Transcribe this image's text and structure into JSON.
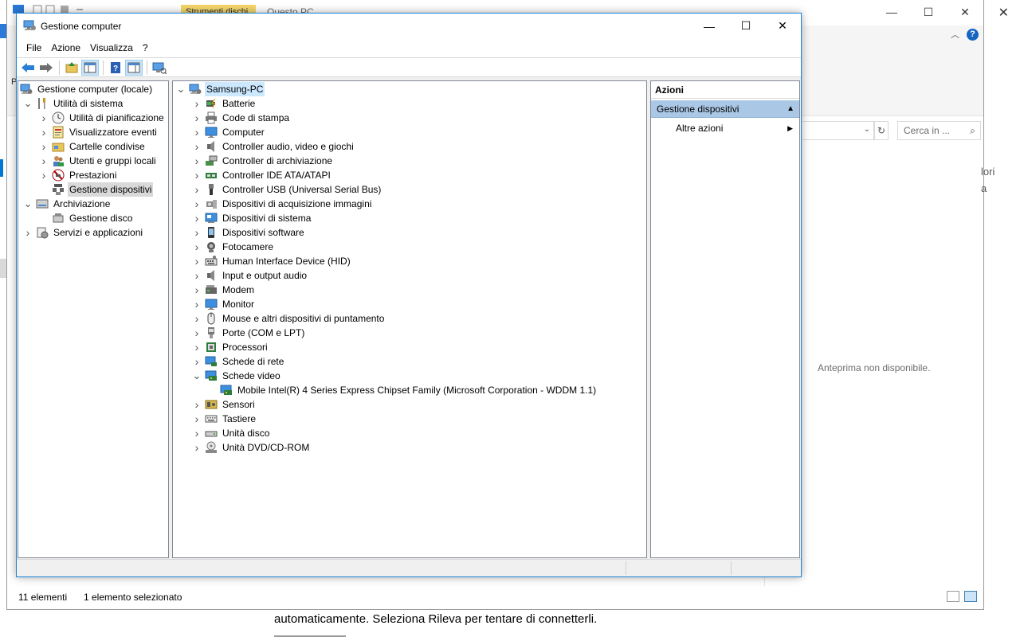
{
  "explorer": {
    "tab_tools": "Strumenti dischi",
    "tab_title": "Questo PC",
    "help": "?",
    "search_placeholder": "Cerca in ...",
    "side_text_line1": "lori",
    "side_text_line2": "a",
    "preview_text": "Anteprima non disponibile.",
    "status_count": "11 elementi",
    "status_selected": "1 elemento selezionato"
  },
  "settings_background": {
    "message": "automaticamente. Seleziona Rileva per tentare di connetterli."
  },
  "window": {
    "title": "Gestione computer",
    "menu": [
      "File",
      "Azione",
      "Visualizza",
      "?"
    ]
  },
  "tree": [
    {
      "label": "Gestione computer (locale)",
      "icon": "computer-management-icon",
      "level": 0,
      "expander": "none"
    },
    {
      "label": "Utilità di sistema",
      "icon": "tools-icon",
      "level": 1,
      "expander": "expanded"
    },
    {
      "label": "Utilità di pianificazione",
      "icon": "clock-icon",
      "level": 2,
      "expander": "collapsed"
    },
    {
      "label": "Visualizzatore eventi",
      "icon": "event-viewer-icon",
      "level": 2,
      "expander": "collapsed"
    },
    {
      "label": "Cartelle condivise",
      "icon": "shared-folder-icon",
      "level": 2,
      "expander": "collapsed"
    },
    {
      "label": "Utenti e gruppi locali",
      "icon": "users-icon",
      "level": 2,
      "expander": "collapsed"
    },
    {
      "label": "Prestazioni",
      "icon": "performance-icon",
      "level": 2,
      "expander": "collapsed"
    },
    {
      "label": "Gestione dispositivi",
      "icon": "device-manager-icon",
      "level": 2,
      "expander": "none",
      "selected": true
    },
    {
      "label": "Archiviazione",
      "icon": "storage-icon",
      "level": 1,
      "expander": "expanded"
    },
    {
      "label": "Gestione disco",
      "icon": "disk-management-icon",
      "level": 2,
      "expander": "none"
    },
    {
      "label": "Servizi e applicazioni",
      "icon": "services-icon",
      "level": 1,
      "expander": "collapsed"
    }
  ],
  "devices": {
    "root": "Samsung-PC",
    "items": [
      {
        "label": "Batterie",
        "icon": "battery-icon",
        "expander": "collapsed"
      },
      {
        "label": "Code di stampa",
        "icon": "printer-icon",
        "expander": "collapsed"
      },
      {
        "label": "Computer",
        "icon": "monitor-icon",
        "expander": "collapsed"
      },
      {
        "label": "Controller audio, video e giochi",
        "icon": "speaker-icon",
        "expander": "collapsed"
      },
      {
        "label": "Controller di archiviazione",
        "icon": "storage-controller-icon",
        "expander": "collapsed"
      },
      {
        "label": "Controller IDE ATA/ATAPI",
        "icon": "ide-controller-icon",
        "expander": "collapsed"
      },
      {
        "label": "Controller USB (Universal Serial Bus)",
        "icon": "usb-icon",
        "expander": "collapsed"
      },
      {
        "label": "Dispositivi di acquisizione immagini",
        "icon": "camera-device-icon",
        "expander": "collapsed"
      },
      {
        "label": "Dispositivi di sistema",
        "icon": "system-device-icon",
        "expander": "collapsed"
      },
      {
        "label": "Dispositivi software",
        "icon": "software-device-icon",
        "expander": "collapsed"
      },
      {
        "label": "Fotocamere",
        "icon": "webcam-icon",
        "expander": "collapsed"
      },
      {
        "label": "Human Interface Device (HID)",
        "icon": "hid-icon",
        "expander": "collapsed"
      },
      {
        "label": "Input e output audio",
        "icon": "speaker-icon",
        "expander": "collapsed"
      },
      {
        "label": "Modem",
        "icon": "modem-icon",
        "expander": "collapsed"
      },
      {
        "label": "Monitor",
        "icon": "monitor-icon",
        "expander": "collapsed"
      },
      {
        "label": "Mouse e altri dispositivi di puntamento",
        "icon": "mouse-icon",
        "expander": "collapsed"
      },
      {
        "label": "Porte (COM e LPT)",
        "icon": "port-icon",
        "expander": "collapsed"
      },
      {
        "label": "Processori",
        "icon": "processor-icon",
        "expander": "collapsed"
      },
      {
        "label": "Schede di rete",
        "icon": "network-adapter-icon",
        "expander": "collapsed"
      },
      {
        "label": "Schede video",
        "icon": "display-adapter-icon",
        "expander": "expanded"
      },
      {
        "label": "Mobile Intel(R) 4 Series Express Chipset Family (Microsoft Corporation - WDDM 1.1)",
        "icon": "display-adapter-icon",
        "expander": "child"
      },
      {
        "label": "Sensori",
        "icon": "sensor-icon",
        "expander": "collapsed"
      },
      {
        "label": "Tastiere",
        "icon": "keyboard-icon",
        "expander": "collapsed"
      },
      {
        "label": "Unità disco",
        "icon": "disk-drive-icon",
        "expander": "collapsed"
      },
      {
        "label": "Unità DVD/CD-ROM",
        "icon": "dvd-icon",
        "expander": "collapsed"
      }
    ]
  },
  "actions": {
    "header": "Azioni",
    "section": "Gestione dispositivi",
    "more": "Altre azioni"
  },
  "colors": {
    "selection": "#cce8ff",
    "accent": "#1883d7",
    "actions_section": "#aac8e6"
  }
}
